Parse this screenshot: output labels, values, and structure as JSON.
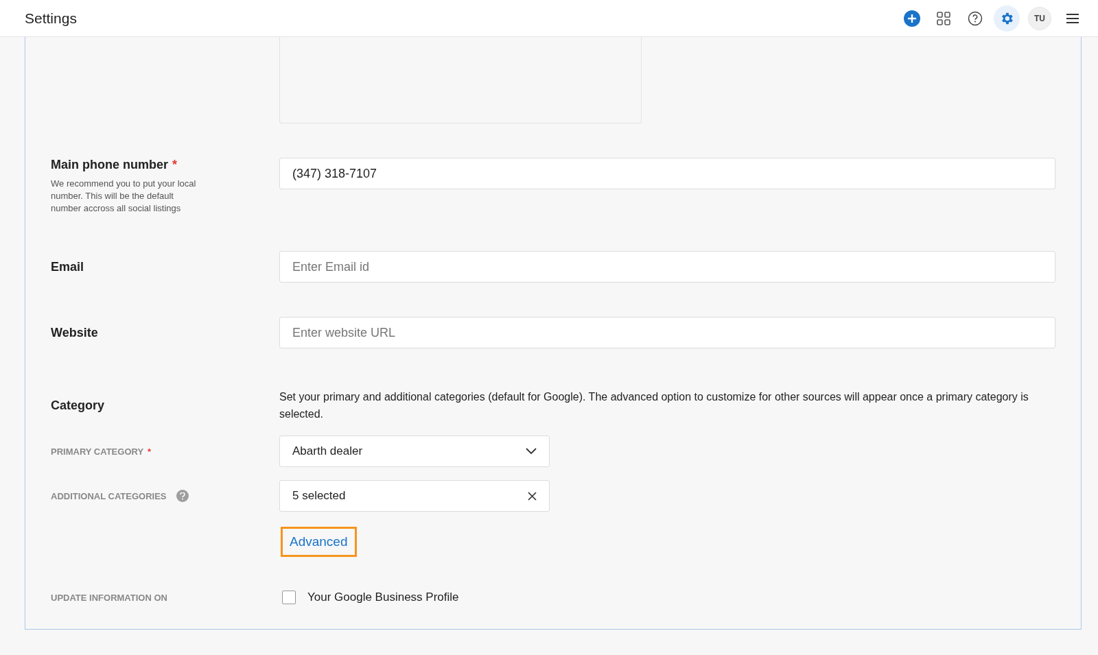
{
  "header": {
    "title": "Settings",
    "avatar": "TU",
    "settings_active": true
  },
  "phone": {
    "label": "Main phone number",
    "required_mark": "*",
    "hint": "We recommend you to put your local number. This will be the default number accross all social listings",
    "value": "(347) 318-7107"
  },
  "email": {
    "label": "Email",
    "placeholder": "Enter Email id"
  },
  "website": {
    "label": "Website",
    "placeholder": "Enter website URL"
  },
  "category": {
    "label": "Category",
    "description": "Set your primary and additional categories (default for Google). The advanced option to customize for other sources will appear once a primary category is selected.",
    "primary": {
      "label": "PRIMARY CATEGORY",
      "required_mark": "*",
      "value": "Abarth dealer"
    },
    "additional": {
      "label": "ADDITIONAL CATEGORIES",
      "value": "5 selected"
    },
    "advanced": "Advanced"
  },
  "update": {
    "label": "UPDATE INFORMATION ON",
    "option": "Your Google Business Profile",
    "checked": false
  }
}
